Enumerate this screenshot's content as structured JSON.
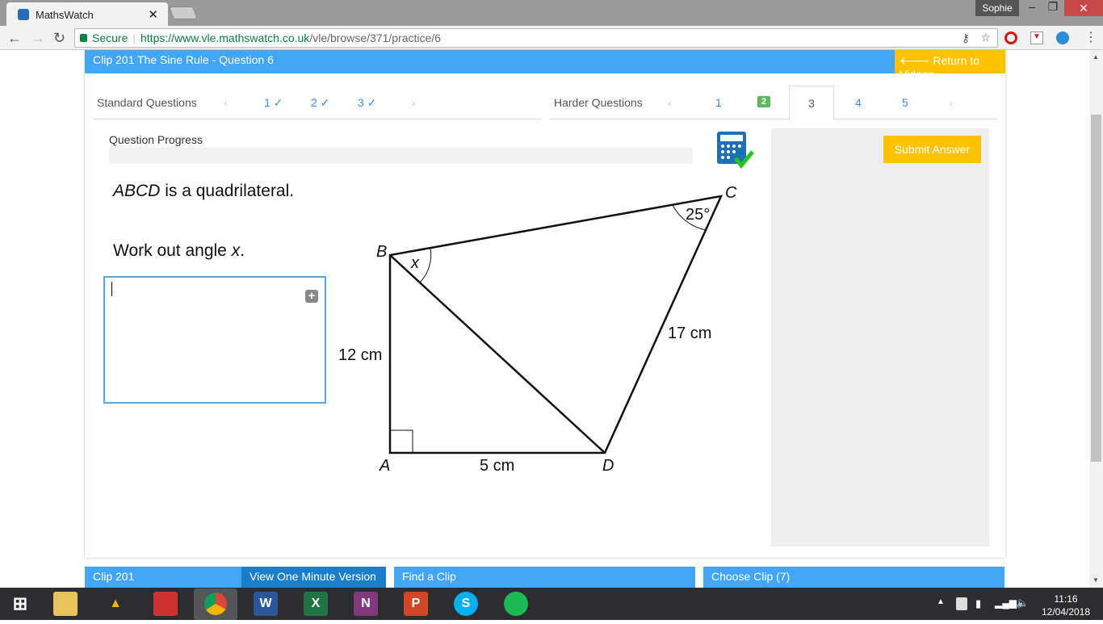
{
  "browser": {
    "tab_title": "MathsWatch",
    "user": "Sophie",
    "secure_label": "Secure",
    "url_host": "https://www.vle.mathswatch.co.uk",
    "url_path": "/vle/browse/371/practice/6"
  },
  "header": {
    "title": "Clip 201 The Sine Rule - Question 6",
    "return_label": "Return to Videos"
  },
  "standard": {
    "label": "Standard Questions",
    "items": [
      "1 ✓",
      "2 ✓",
      "3 ✓"
    ]
  },
  "harder": {
    "label": "Harder Questions",
    "items": [
      "1",
      "2",
      "3",
      "4",
      "5"
    ],
    "active": "3"
  },
  "progress": {
    "label": "Question Progress",
    "value": 0
  },
  "question": {
    "line1_italic": "ABCD",
    "line1_rest": " is a quadrilateral.",
    "line2": "Work out angle ",
    "line2_var": "x",
    "line2_end": "."
  },
  "diagram": {
    "A": "A",
    "B": "B",
    "C": "C",
    "D": "D",
    "x": "x",
    "angle_c": "25°",
    "ab": "12 cm",
    "ad": "5 cm",
    "cd": "17 cm"
  },
  "submit_label": "Submit Answer",
  "bottom": {
    "clip": "Clip 201",
    "one_min": "View One Minute Version",
    "find": "Find a Clip",
    "choose": "Choose Clip (7)"
  },
  "taskbar": {
    "time": "11:16",
    "date": "12/04/2018"
  }
}
